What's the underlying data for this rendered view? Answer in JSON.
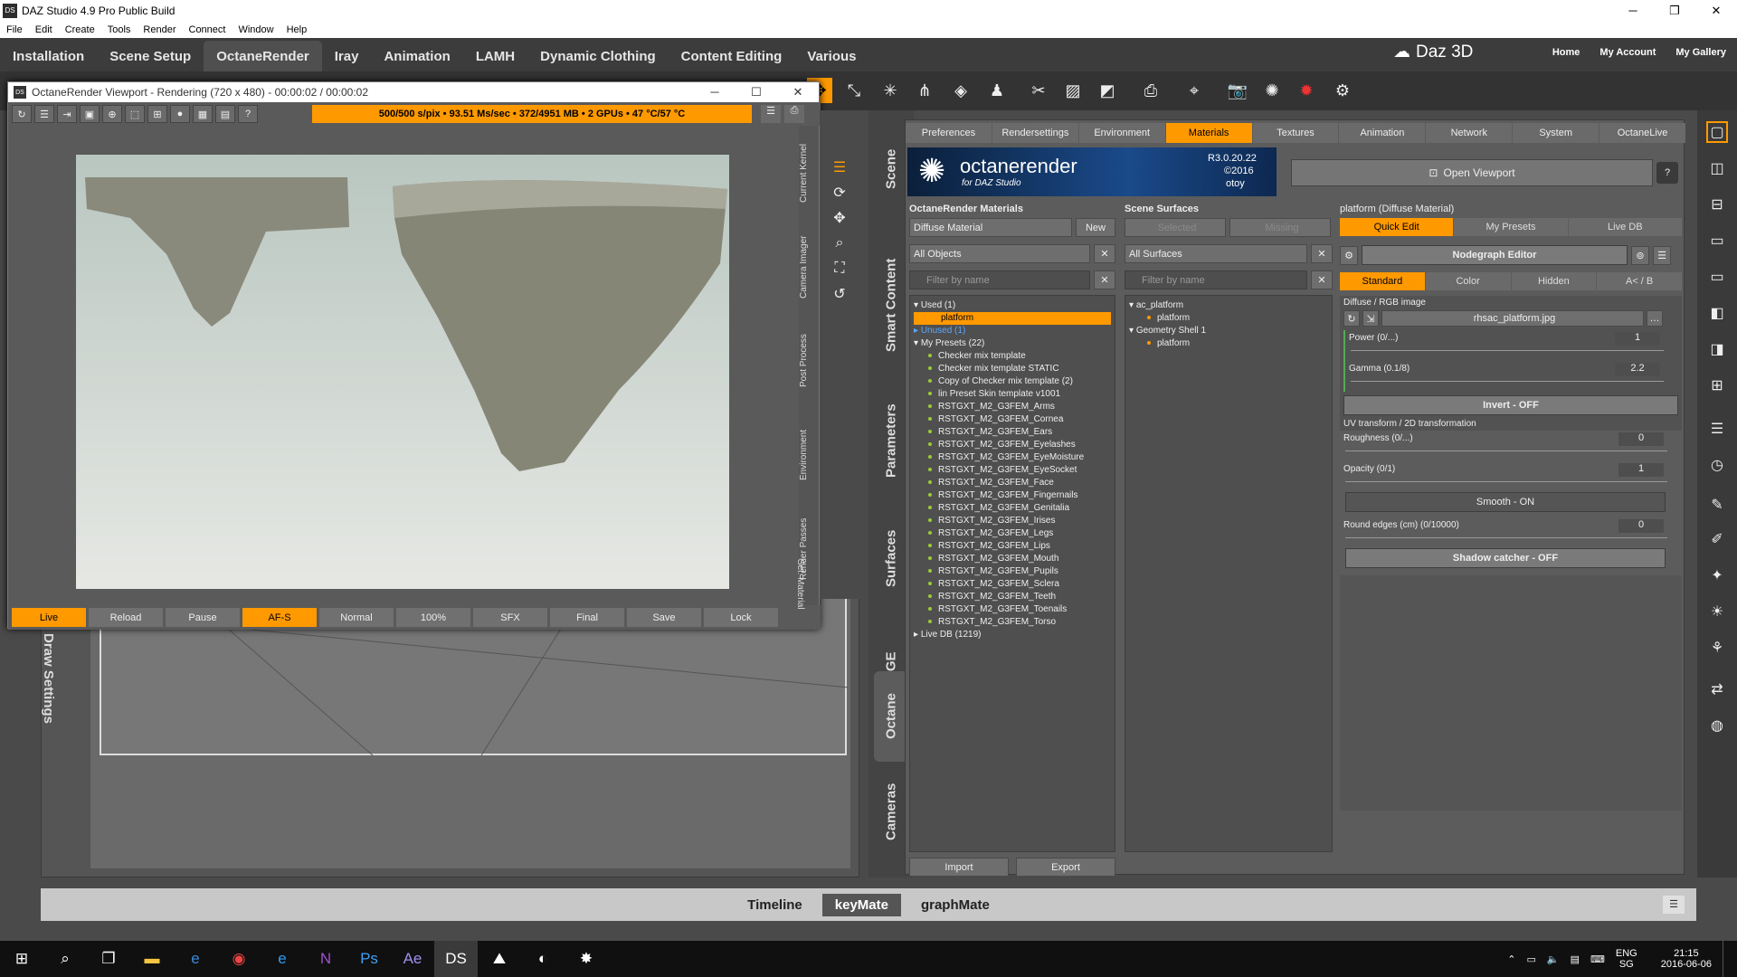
{
  "window": {
    "title": "DAZ Studio 4.9 Pro Public Build",
    "icon": "DS"
  },
  "menu": [
    "File",
    "Edit",
    "Create",
    "Tools",
    "Render",
    "Connect",
    "Window",
    "Help"
  ],
  "tabs": [
    "Installation",
    "Scene Setup",
    "OctaneRender",
    "Iray",
    "Animation",
    "LAMH",
    "Dynamic Clothing",
    "Content Editing",
    "Various"
  ],
  "active_tab": "OctaneRender",
  "logo": "Daz 3D",
  "topnav": [
    "Home",
    "My Account",
    "My Gallery"
  ],
  "viewport": {
    "title": "OctaneRender Viewport - Rendering (720 x 480) - 00:00:02 / 00:00:02",
    "status": "500/500 s/pix • 93.51 Ms/sec • 372/4951 MB • 2 GPUs • 47 °C/57 °C",
    "side_tabs": [
      "Current Kernel",
      "Camera Imager",
      "Post Process",
      "Environment",
      "Render Passes",
      "Sel. Material"
    ],
    "bottom": [
      "Live",
      "Reload",
      "Pause",
      "AF-S",
      "Normal",
      "100%",
      "SFX",
      "Final",
      "Save",
      "Lock"
    ]
  },
  "draw_settings": "Draw Settings",
  "side_tabs": [
    "Scene",
    "Smart Content",
    "Parameters",
    "Surfaces",
    "NGE",
    "Octane",
    "Cameras"
  ],
  "panel_tabs": [
    "Preferences",
    "Rendersettings",
    "Environment",
    "Materials",
    "Textures",
    "Animation",
    "Network",
    "System",
    "OctaneLive"
  ],
  "active_panel_tab": "Materials",
  "banner": {
    "brand": "octanerender",
    "sub": "for DAZ Studio",
    "version": "R3.0.20.22",
    "year": "©2016",
    "company": "otoy"
  },
  "open_viewport": "Open Viewport",
  "materials": {
    "heading": "OctaneRender Materials",
    "type": "Diffuse Material",
    "new": "New",
    "objects": "All Objects",
    "filter": "Filter by name",
    "used": "Used (1)",
    "used_item": "platform",
    "unused": "Unused (1)",
    "presets": "My Presets (22)",
    "preset_items": [
      "Checker mix template",
      "Checker mix template STATIC",
      "Copy of Checker mix template (2)",
      "lin Preset Skin template v1001",
      "RSTGXT_M2_G3FEM_Arms",
      "RSTGXT_M2_G3FEM_Cornea",
      "RSTGXT_M2_G3FEM_Ears",
      "RSTGXT_M2_G3FEM_Eyelashes",
      "RSTGXT_M2_G3FEM_EyeMoisture",
      "RSTGXT_M2_G3FEM_EyeSocket",
      "RSTGXT_M2_G3FEM_Face",
      "RSTGXT_M2_G3FEM_Fingernails",
      "RSTGXT_M2_G3FEM_Genitalia",
      "RSTGXT_M2_G3FEM_Irises",
      "RSTGXT_M2_G3FEM_Legs",
      "RSTGXT_M2_G3FEM_Lips",
      "RSTGXT_M2_G3FEM_Mouth",
      "RSTGXT_M2_G3FEM_Pupils",
      "RSTGXT_M2_G3FEM_Sclera",
      "RSTGXT_M2_G3FEM_Teeth",
      "RSTGXT_M2_G3FEM_Toenails",
      "RSTGXT_M2_G3FEM_Torso"
    ],
    "livedb": "Live DB (1219)",
    "import": "Import",
    "export": "Export"
  },
  "surfaces": {
    "heading": "Scene Surfaces",
    "selected": "Selected",
    "missing": "Missing",
    "all": "All Surfaces",
    "filter": "Filter by name",
    "tree": [
      {
        "name": "ac_platform",
        "child": "platform"
      },
      {
        "name": "Geometry Shell 1",
        "child": "platform"
      }
    ]
  },
  "edit": {
    "heading": "platform (Diffuse Material)",
    "tabs": [
      "Quick Edit",
      "My Presets",
      "Live DB"
    ],
    "nodegraph": "Nodegraph Editor",
    "subtabs": [
      "Standard",
      "Color",
      "Hidden",
      "A< / B"
    ],
    "diffuse_label": "Diffuse / RGB image",
    "image": "rhsac_platform.jpg",
    "power": {
      "label": "Power (0/...)",
      "value": "1"
    },
    "gamma": {
      "label": "Gamma (0.1/8)",
      "value": "2.2"
    },
    "invert": "Invert - OFF",
    "uv": "UV transform / 2D transformation",
    "roughness": {
      "label": "Roughness (0/...)",
      "value": "0"
    },
    "opacity": {
      "label": "Opacity (0/1)",
      "value": "1"
    },
    "smooth": "Smooth - ON",
    "round": {
      "label": "Round edges (cm) (0/10000)",
      "value": "0"
    },
    "shadow": "Shadow catcher - OFF"
  },
  "bottom_tabs": [
    "Timeline",
    "keyMate",
    "graphMate"
  ],
  "active_bottom": "keyMate",
  "taskbar": {
    "lang": "ENG",
    "region": "SG",
    "time": "21:15",
    "date": "2016-06-06"
  }
}
